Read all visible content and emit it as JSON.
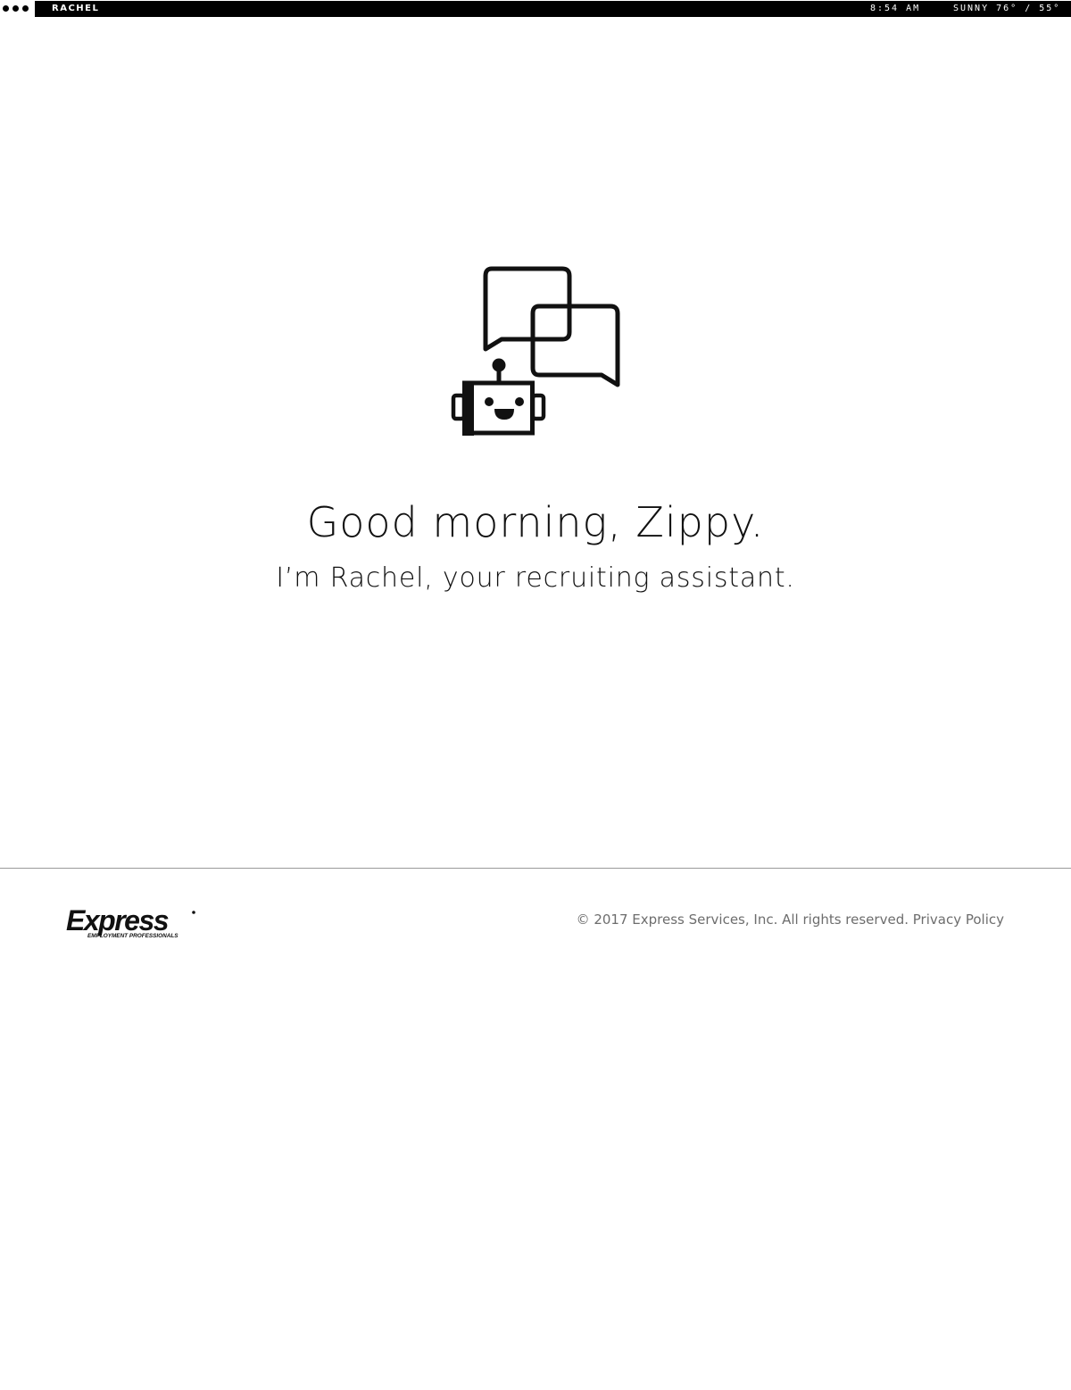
{
  "topbar": {
    "app_name": "RACHEL",
    "time": "8:54 AM",
    "weather": "SUNNY 76° / 55°",
    "menu_icon": "three-dots-icon"
  },
  "hero": {
    "icon": "chatbot-icon",
    "greeting": "Good morning, Zippy.",
    "intro": "I’m Rachel, your recruiting assistant."
  },
  "footer": {
    "logo_text": "Express",
    "logo_tagline": "EMPLOYMENT PROFESSIONALS",
    "copyright": "© 2017 Express Services, Inc. All rights reserved.",
    "privacy_link": "Privacy Policy"
  },
  "colors": {
    "bar_background": "#000000",
    "text": "#111111",
    "footer_text": "#6d6d6d",
    "divider": "#9a9a9a"
  }
}
